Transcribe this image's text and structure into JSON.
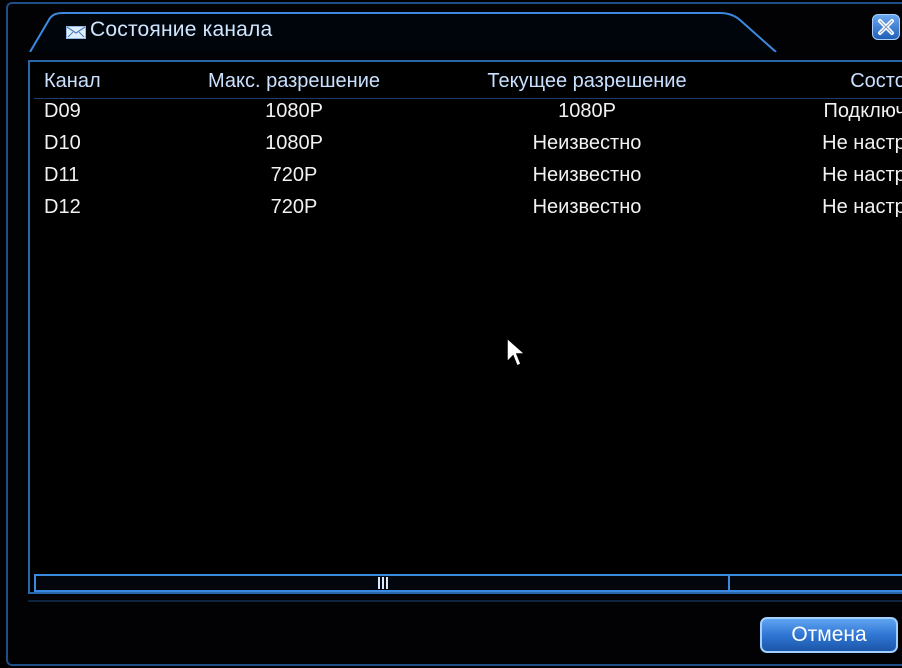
{
  "window": {
    "title": "Состояние канала",
    "title_icon": "envelope-icon",
    "close_icon": "close-icon"
  },
  "table": {
    "headers": {
      "channel": "Канал",
      "max_resolution": "Макс. разрешение",
      "current_resolution": "Текущее разрешение",
      "status": "Состояние"
    },
    "rows": [
      {
        "channel": "D09",
        "max_resolution": "1080P",
        "current_resolution": "1080P",
        "status": "Подключен"
      },
      {
        "channel": "D10",
        "max_resolution": "1080P",
        "current_resolution": "Неизвестно",
        "status": "Не настрое"
      },
      {
        "channel": "D11",
        "max_resolution": "720P",
        "current_resolution": "Неизвестно",
        "status": "Не настрое"
      },
      {
        "channel": "D12",
        "max_resolution": "720P",
        "current_resolution": "Неизвестно",
        "status": "Не настрое"
      }
    ]
  },
  "footer": {
    "cancel_label": "Отмена"
  },
  "colors": {
    "accent": "#2f76d4",
    "border": "#3c8ae0",
    "text": "#f2f2f2"
  }
}
